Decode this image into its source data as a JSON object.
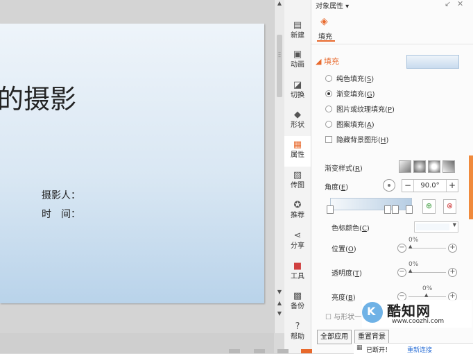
{
  "slide": {
    "title": "的摄影",
    "field_photographer": "摄影人：",
    "field_time": "时　间："
  },
  "side_tabs": [
    {
      "label": "新建",
      "icon": "new-document-icon"
    },
    {
      "label": "动画",
      "icon": "animation-icon"
    },
    {
      "label": "切换",
      "icon": "transition-icon"
    },
    {
      "label": "形状",
      "icon": "shapes-icon"
    },
    {
      "label": "属性",
      "icon": "properties-icon"
    },
    {
      "label": "传图",
      "icon": "upload-image-icon"
    },
    {
      "label": "推荐",
      "icon": "recommend-icon"
    },
    {
      "label": "分享",
      "icon": "share-icon"
    },
    {
      "label": "工具",
      "icon": "toolbox-icon"
    },
    {
      "label": "备份",
      "icon": "backup-icon"
    },
    {
      "label": "帮助",
      "icon": "help-icon"
    }
  ],
  "panel": {
    "header": "对象属性 ▾",
    "fill_tab": "填充",
    "section_fill": "◢ 填充",
    "fill_options": [
      {
        "text": "纯色填充(",
        "key": "S",
        "end": ")",
        "selected": false
      },
      {
        "text": "渐变填充(",
        "key": "G",
        "end": ")",
        "selected": true
      },
      {
        "text": "图片或纹理填充(",
        "key": "P",
        "end": ")",
        "selected": false
      },
      {
        "text": "图案填充(",
        "key": "A",
        "end": ")",
        "selected": false
      }
    ],
    "hide_background": {
      "text": "隐藏背景图形(",
      "key": "H",
      "end": ")",
      "checked": false
    },
    "gradient_style": {
      "text": "渐变样式(",
      "key": "R",
      "end": ")"
    },
    "angle": {
      "text": "角度(",
      "key": "E",
      "end": ")",
      "value": "90.0°"
    },
    "stop_color": {
      "text": "色标颜色(",
      "key": "C",
      "end": ")"
    },
    "position": {
      "text": "位置(",
      "key": "O",
      "end": ")",
      "value": "0%",
      "percent": 0
    },
    "transparency": {
      "text": "透明度(",
      "key": "T",
      "end": ")",
      "value": "0%",
      "percent": 0
    },
    "brightness": {
      "text": "亮度(",
      "key": "B",
      "end": ")",
      "value": "0%",
      "percent": 50
    },
    "more_row": "☐ 与形状一",
    "apply_all": "全部应用",
    "reset": "重置背景"
  },
  "watermark": {
    "logo_letter": "K",
    "name": "酷知网",
    "url": "www.coozhi.com"
  },
  "status": {
    "text": "已断开！",
    "link": "重新连接"
  },
  "colors": {
    "accent": "#e8692c",
    "slide_gradient_top": "#eef4fa",
    "slide_gradient_bottom": "#b9d3ea",
    "link": "#2a6fd6"
  }
}
